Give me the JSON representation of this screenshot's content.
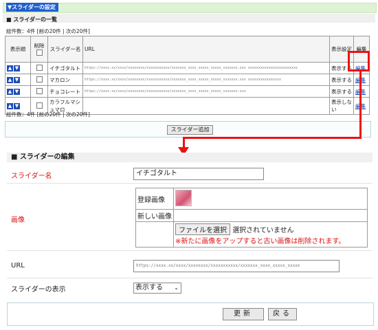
{
  "top": {
    "section_title": "▼スライダーの設定",
    "list_title": "■ スライダーの一覧",
    "count_text": "総件数：4件 [前の20件 | 次の20件]",
    "count_text_bottom": "総件数：4件 [前の20件 | 次の20件]"
  },
  "table": {
    "headers": {
      "order": "表示順",
      "delete": "削除",
      "name": "スライダー名",
      "url": "URL",
      "display": "表示設定",
      "edit": "編集"
    },
    "rows": [
      {
        "name": "イチゴタルト",
        "url": "https://xxxx.xx/xxxx/xxxxxxxx/xxxxxxxxxxx/xxxxxxx_xxxx_xxxxx_xxxxx_xxxxxxx.xxx  xxxxxxxxxxxxxxxxxxxxxxxx",
        "display": "表示する",
        "edit": "編集"
      },
      {
        "name": "マカロン",
        "url": "https://xxxx.xx/xxxx/xxxxxxxx/xxxxxxxxxxx/xxxxxxx_xxxx_xxxxx_xxxxx_xxxxxxx.xxx  xxxxxxxxxxxxxxxx",
        "display": "表示する",
        "edit": "編集"
      },
      {
        "name": "チョコレート",
        "url": "https://xxxx.xx/xxxx/xxxxxxxx/xxxxxxxxxxx/xxxxxxx_xxxx_xxxxx_xxxxx_xxxxxxx.xxx",
        "display": "表示する",
        "edit": "編集"
      },
      {
        "name": "カラフルマシュマロ",
        "url": "",
        "display": "表示しない",
        "edit": "編集"
      }
    ],
    "add_button": "スライダー追加"
  },
  "edit": {
    "title": "■ スライダーの編集",
    "name_label": "スライダー名",
    "name_value": "イチゴタルト",
    "image_label": "画像",
    "registered_image": "登録画像",
    "new_image": "新しい画像",
    "file_button": "ファイルを選択",
    "file_status": "選択されていません",
    "warning": "※新たに画像をアップすると古い画像は削除されます。",
    "url_label": "URL",
    "url_value": "https://xxxx.xx/xxxx/xxxxxxxx/xxxxxxxxxxx/xxxxxxx_xxxx_xxxxx_xxxxx",
    "display_label": "スライダーの表示",
    "display_value": "表示する",
    "update_button": "更新",
    "back_button": "戻る"
  },
  "colors": {
    "accent": "#1f5fd0",
    "highlight": "#ee1111",
    "required_label": "#dd1111"
  }
}
